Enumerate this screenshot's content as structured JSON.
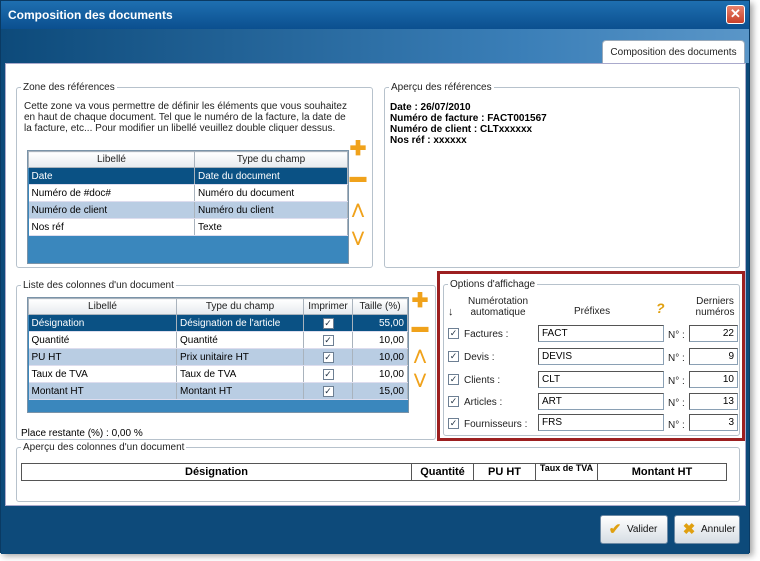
{
  "window": {
    "title": "Composition des documents",
    "tab": "Composition des documents"
  },
  "references": {
    "legend": "Zone des références",
    "description": "Cette zone va vous permettre de définir les éléments que vous souhaitez en haut de chaque document. Tel que le numéro de la facture, la date de la facture, etc... Pour modifier un libellé veuillez double cliquer dessus.",
    "columns": [
      "Libellé",
      "Type du champ"
    ],
    "rows": [
      [
        "Date",
        "Date du document"
      ],
      [
        "Numéro de #doc#",
        "Numéro du document"
      ],
      [
        "Numéro de client",
        "Numéro du client"
      ],
      [
        "Nos réf",
        "Texte"
      ]
    ]
  },
  "preview_refs": {
    "legend": "Aperçu des références",
    "lines": [
      "Date : 26/07/2010",
      "Numéro de facture : FACT001567",
      "Numéro de client : CLTxxxxxx",
      "Nos réf : xxxxxx"
    ]
  },
  "columns_list": {
    "legend": "Liste des colonnes d'un document",
    "headers": [
      "Libellé",
      "Type du champ",
      "Imprimer",
      "Taille (%)"
    ],
    "rows": [
      [
        "Désignation",
        "Désignation de l'article",
        "✓",
        "55,00"
      ],
      [
        "Quantité",
        "Quantité",
        "✓",
        "10,00"
      ],
      [
        "PU HT",
        "Prix unitaire HT",
        "✓",
        "10,00"
      ],
      [
        "Taux de TVA",
        "Taux de TVA",
        "✓",
        "10,00"
      ],
      [
        "Montant HT",
        "Montant HT",
        "✓",
        "15,00"
      ]
    ],
    "remaining": "Place restante (%) :  0,00 %"
  },
  "options": {
    "legend": "Options d'affichage",
    "col_numerotation": "Numérotation automatique",
    "col_prefixes": "Préfixes",
    "col_derniers": "Derniers numéros",
    "no_label": "N° :",
    "help_icon": "?",
    "rows": [
      {
        "label": "Factures :",
        "prefix": "FACT",
        "number": "22"
      },
      {
        "label": "Devis :",
        "prefix": "DEVIS",
        "number": "9"
      },
      {
        "label": "Clients :",
        "prefix": "CLT",
        "number": "10"
      },
      {
        "label": "Articles :",
        "prefix": "ART",
        "number": "13"
      },
      {
        "label": "Fournisseurs :",
        "prefix": "FRS",
        "number": "3"
      }
    ]
  },
  "preview_columns": {
    "legend": "Aperçu des colonnes d'un document",
    "cols": [
      "Désignation",
      "Quantité",
      "PU HT",
      "Taux de TVA",
      "Montant HT"
    ]
  },
  "buttons": {
    "validate": "Valider",
    "cancel": "Annuler"
  },
  "colors": {
    "frame_blue": "#0d4a7a",
    "selected_row": "#0a5184",
    "alt_row": "#b9cde3",
    "highlight_border": "#9c1f20",
    "accent_orange": "#f0a21b"
  }
}
